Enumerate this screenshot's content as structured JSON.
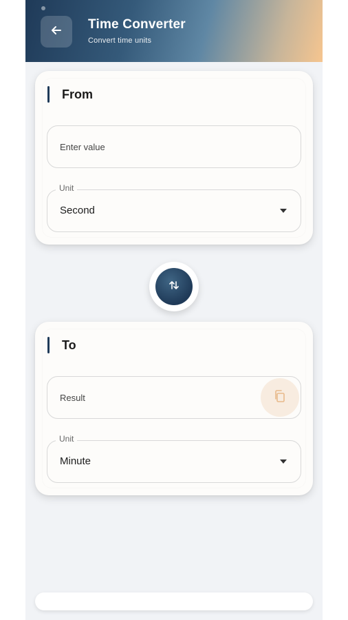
{
  "header": {
    "title": "Time Converter",
    "subtitle": "Convert time units",
    "back_icon": "arrow-left-icon"
  },
  "from_card": {
    "title": "From",
    "value_placeholder": "Enter value",
    "unit_label": "Unit",
    "unit_selected": "Second"
  },
  "swap": {
    "icon": "swap-vertical-icon"
  },
  "to_card": {
    "title": "To",
    "result_placeholder": "Result",
    "copy_icon": "copy-icon",
    "unit_label": "Unit",
    "unit_selected": "Minute"
  },
  "colors": {
    "accent": "#1f3a58",
    "background": "#f1f3f6",
    "card": "#fdfcfa",
    "copy_accent": "#e8a35a"
  }
}
